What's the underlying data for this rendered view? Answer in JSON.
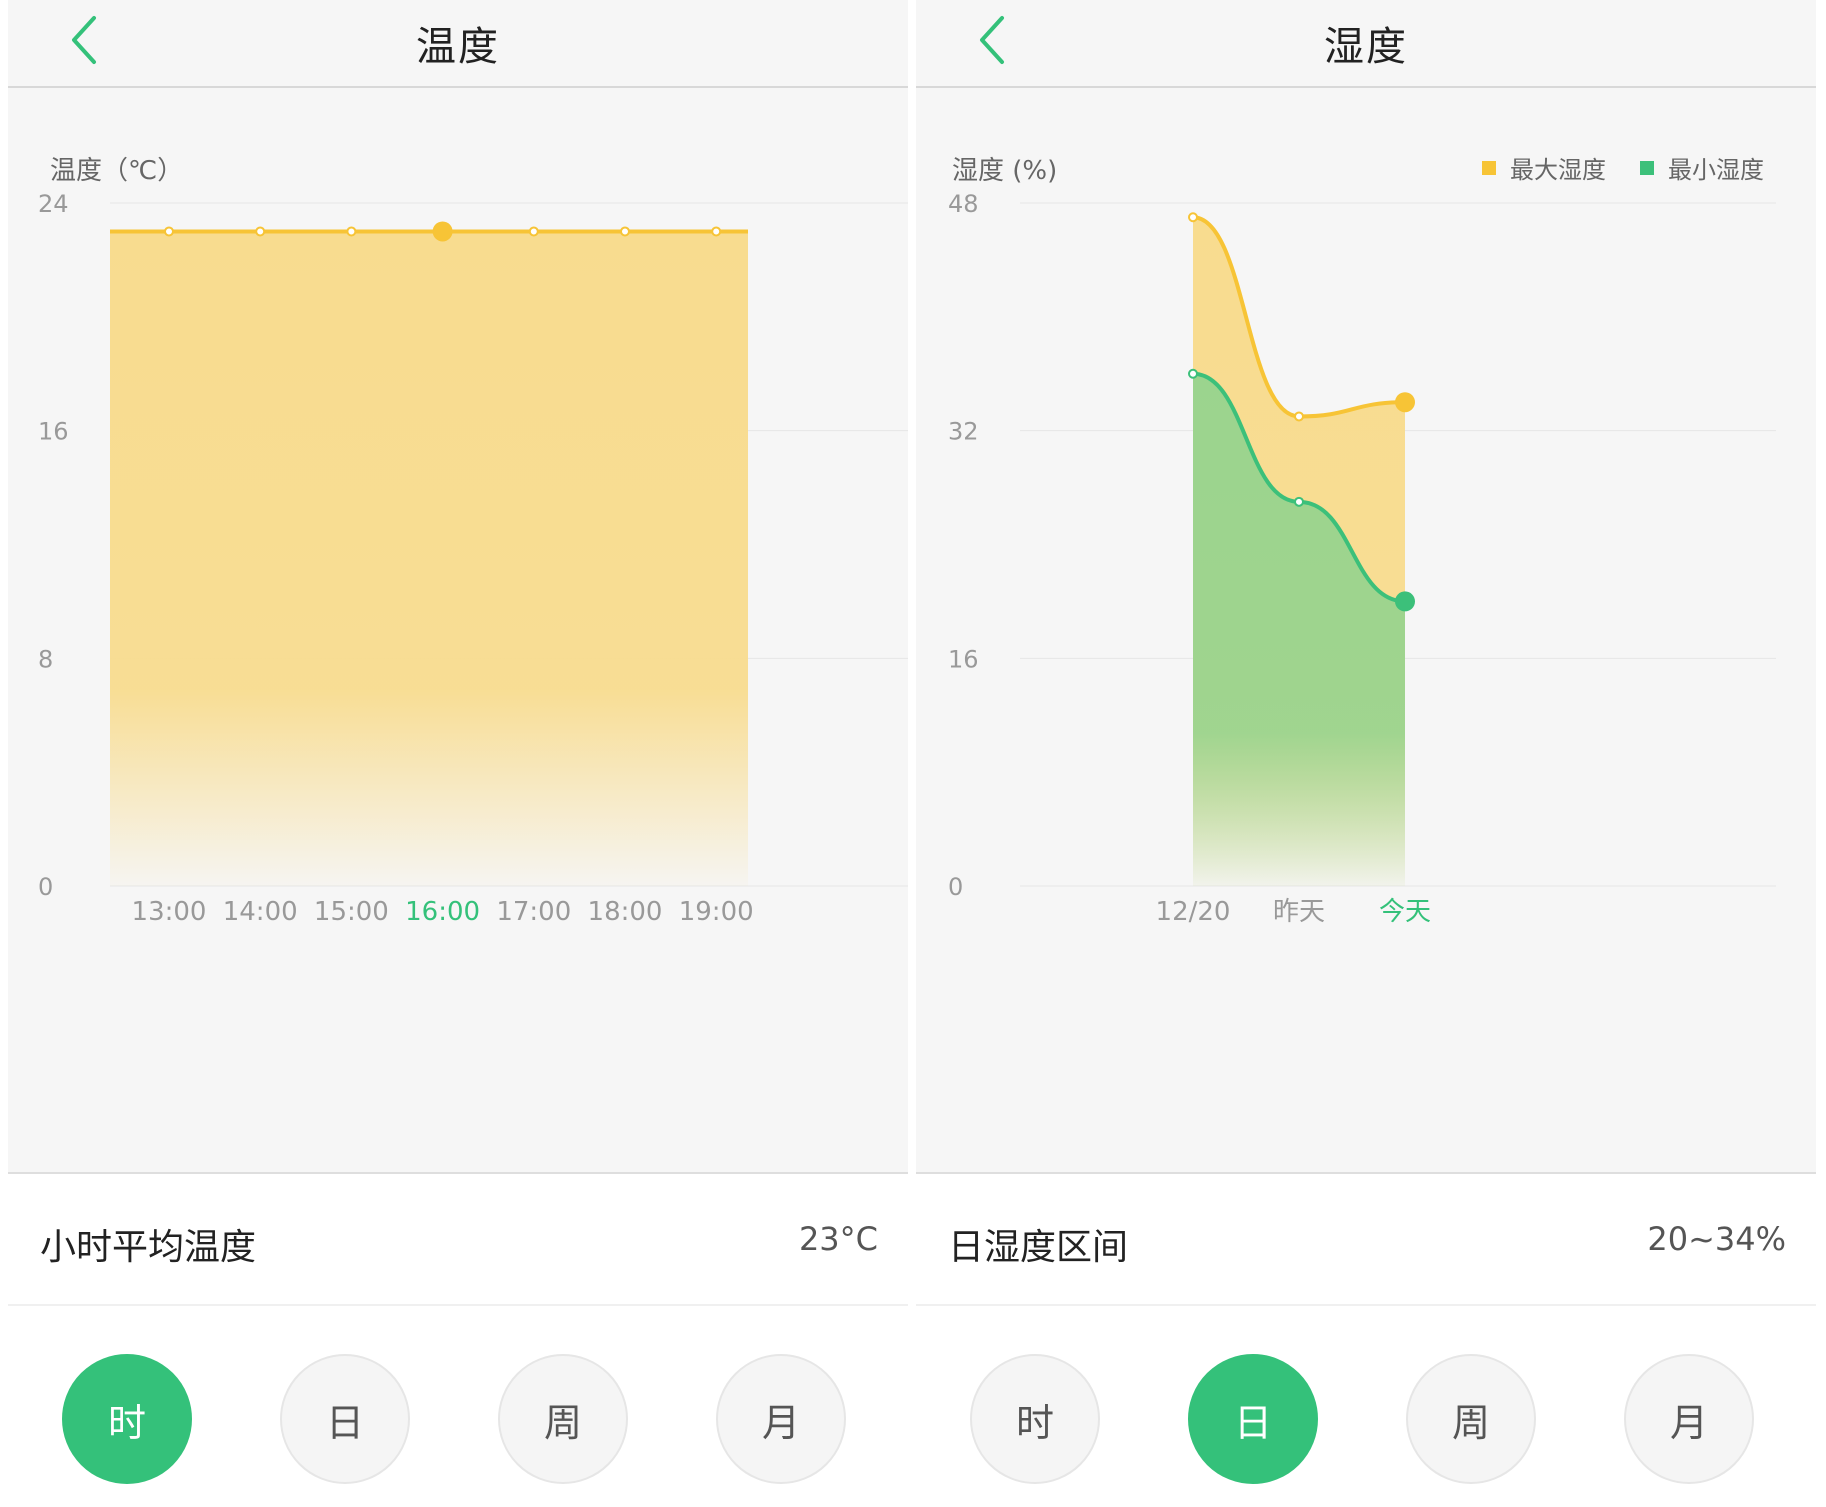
{
  "colors": {
    "accent": "#34c17a",
    "max_line": "#f7c436",
    "max_fill": "#f8dc8f",
    "min_line": "#3cc07a",
    "min_fill": "#9bd48e",
    "header_bg": "#f6f6f6"
  },
  "temperature": {
    "title": "温度",
    "y_axis_label": "温度（℃）",
    "summary_label": "小时平均温度",
    "summary_value": "23°C",
    "periods": [
      {
        "label": "时",
        "active": true
      },
      {
        "label": "日",
        "active": false
      },
      {
        "label": "周",
        "active": false
      },
      {
        "label": "月",
        "active": false
      }
    ]
  },
  "humidity": {
    "title": "湿度",
    "y_axis_label": "湿度 (%)",
    "legend": [
      {
        "label": "最大湿度",
        "color": "#f7c436"
      },
      {
        "label": "最小湿度",
        "color": "#3cc07a"
      }
    ],
    "summary_label": "日湿度区间",
    "summary_value": "20~34%",
    "periods": [
      {
        "label": "时",
        "active": false
      },
      {
        "label": "日",
        "active": true
      },
      {
        "label": "周",
        "active": false
      },
      {
        "label": "月",
        "active": false
      }
    ]
  },
  "chart_data": [
    {
      "type": "area",
      "title": "",
      "ylabel": "温度（℃）",
      "ylim": [
        0,
        24
      ],
      "yticks": [
        "0",
        "8",
        "16",
        "24"
      ],
      "x": [
        "13:00",
        "14:00",
        "15:00",
        "16:00",
        "17:00",
        "18:00",
        "19:00"
      ],
      "highlight_index": 3,
      "series": [
        {
          "values": [
            23,
            23,
            23,
            23,
            23,
            23,
            23
          ]
        }
      ],
      "grid": true
    },
    {
      "type": "area",
      "title": "",
      "ylabel": "湿度 (%)",
      "ylim": [
        0,
        48
      ],
      "yticks": [
        "0",
        "16",
        "32",
        "48"
      ],
      "x": [
        "12/20",
        "昨天",
        "今天"
      ],
      "highlight_index": 2,
      "series": [
        {
          "name": "最大湿度",
          "values": [
            47,
            33,
            34
          ]
        },
        {
          "name": "最小湿度",
          "values": [
            36,
            27,
            20
          ]
        }
      ],
      "legend": "top-right",
      "grid": true
    }
  ]
}
